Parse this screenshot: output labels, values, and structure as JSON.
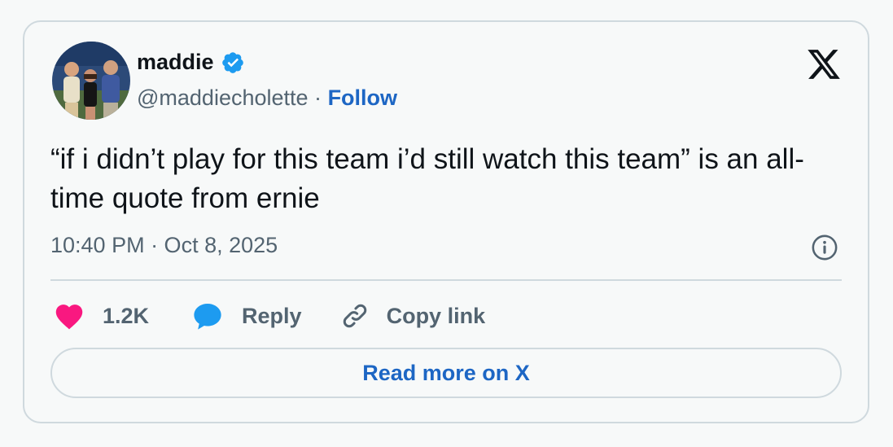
{
  "author": {
    "display_name": "maddie",
    "handle": "@maddiecholette",
    "separator": "·",
    "follow_label": "Follow",
    "verified_icon": "verified-badge-icon",
    "avatar": "avatar-photo"
  },
  "tweet": {
    "text": "“if i didn’t play for this team i’d still watch this team” is an all-time quote from ernie",
    "timestamp": "10:40 PM · Oct 8, 2025"
  },
  "actions": {
    "like_count": "1.2K",
    "reply_label": "Reply",
    "copy_link_label": "Copy link"
  },
  "footer": {
    "read_more_label": "Read more on X"
  },
  "icons": {
    "brand": "x-logo-icon",
    "info": "info-icon",
    "like": "heart-icon",
    "reply": "speech-bubble-icon",
    "copy": "link-icon"
  },
  "colors": {
    "background": "#f7f9f9",
    "border": "#cfd9de",
    "text_primary": "#0f1419",
    "text_secondary": "#536471",
    "link": "#1d66c4",
    "verified": "#1d9bf0",
    "like": "#f91880",
    "reply": "#1d9bf0"
  }
}
